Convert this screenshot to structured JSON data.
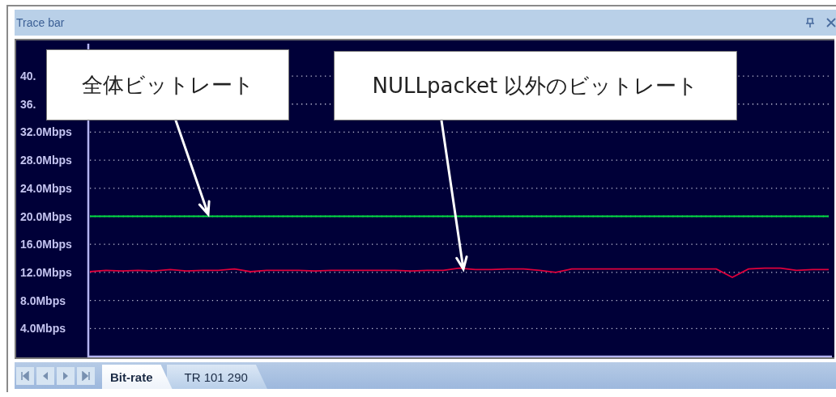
{
  "panel": {
    "title": "Trace bar"
  },
  "callouts": [
    {
      "text": "全体ビットレート"
    },
    {
      "text": "NULLpacket 以外のビットレート"
    }
  ],
  "chart_data": {
    "type": "line",
    "grid": true,
    "ylim": [
      0,
      44.5
    ],
    "yticks": [
      {
        "value": 40,
        "label": "40."
      },
      {
        "value": 36,
        "label": "36."
      },
      {
        "value": 32,
        "label": "32.0Mbps"
      },
      {
        "value": 28,
        "label": "28.0Mbps"
      },
      {
        "value": 24,
        "label": "24.0Mbps"
      },
      {
        "value": 20,
        "label": "20.0Mbps"
      },
      {
        "value": 16,
        "label": "16.0Mbps"
      },
      {
        "value": 12,
        "label": "12.0Mbps"
      },
      {
        "value": 8,
        "label": "8.0Mbps"
      },
      {
        "value": 4,
        "label": "4.0Mbps"
      }
    ],
    "series": [
      {
        "color": "#00e040",
        "values": [
          20,
          20,
          20,
          20,
          20,
          20,
          20,
          20,
          20,
          20,
          20,
          20,
          20,
          20,
          20,
          20,
          20,
          20,
          20,
          20,
          20,
          20,
          20,
          20,
          20,
          20,
          20,
          20,
          20,
          20,
          20,
          20,
          20,
          20,
          20,
          20,
          20,
          20,
          20,
          20,
          20,
          20,
          20,
          20,
          20,
          20,
          20
        ]
      },
      {
        "color": "#e0003c",
        "values": [
          12.1,
          12.3,
          12.2,
          12.3,
          12.2,
          12.4,
          12.2,
          12.3,
          12.3,
          12.5,
          12.1,
          12.3,
          12.3,
          12.3,
          12.2,
          12.3,
          12.3,
          12.3,
          12.3,
          12.3,
          12.2,
          12.3,
          12.3,
          12.6,
          12.4,
          12.4,
          12.5,
          12.5,
          12.3,
          12.0,
          12.5,
          12.5,
          12.5,
          12.5,
          12.5,
          12.5,
          12.5,
          12.5,
          12.5,
          12.5,
          11.3,
          12.5,
          12.6,
          12.6,
          12.3,
          12.4,
          12.4
        ]
      }
    ]
  },
  "tabs": [
    {
      "label": "Bit-rate",
      "selected": true
    },
    {
      "label": "TR 101 290",
      "selected": false
    }
  ]
}
